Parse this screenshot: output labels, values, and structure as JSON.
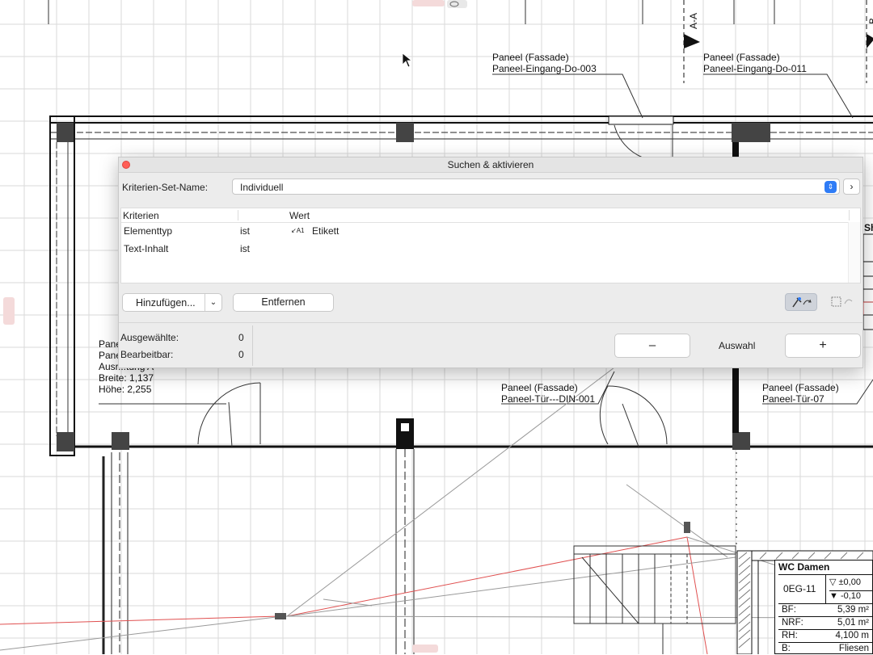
{
  "dialog": {
    "title": "Suchen & aktivieren",
    "set_label": "Kriterien-Set-Name:",
    "set_value": "Individuell",
    "more_glyph": "›",
    "table": {
      "headers": [
        "Kriterien",
        "Wert"
      ],
      "rows": [
        {
          "criterion": "Elementtyp",
          "operator": "ist",
          "value_icon": "label-tool-icon",
          "value_icon_text": "A1",
          "value": "Etikett"
        },
        {
          "criterion": "Text-Inhalt",
          "operator": "ist",
          "value": ""
        }
      ]
    },
    "add_button": "Hinzufügen...",
    "remove_button": "Entfernen",
    "selected_label": "Ausgewählte:",
    "selected_count": "0",
    "editable_label": "Bearbeitbar:",
    "editable_count": "0",
    "selection_label": "Auswahl",
    "minus_button": "–",
    "plus_button": "+",
    "icons": [
      "close-icon",
      "stepper-icon",
      "chevron-right-icon",
      "chevron-down-icon",
      "eyedropper-icon",
      "marquee-icon"
    ]
  },
  "plan": {
    "section_marker_a": "A-A",
    "section_marker_b": "B",
    "labels": [
      {
        "line1": "Paneel (Fassade)",
        "line2": "Paneel-Eingang-Do-003"
      },
      {
        "line1": "Paneel (Fassade)",
        "line2": "Paneel-Eingang-Do-011"
      },
      {
        "line1": "Paneel (Fassade)",
        "line2": "Paneel-Tür---DIN-001"
      },
      {
        "line1": "Paneel (Fassade)",
        "line2": "Paneel-Tür-07"
      }
    ],
    "left_label": {
      "l1": "Pane",
      "l2": "Pane",
      "l3": "Ausr...tung A",
      "l4": "Breite: 1,137",
      "l5": "Höhe: 2,255"
    },
    "right_edge_label": "Sh",
    "room": {
      "name": "WC Damen",
      "id": "0EG-11",
      "level_top": "▽ ±0,00",
      "level_bottom": "▼ -0,10",
      "rows": [
        {
          "k": "BF:",
          "v": "5,39 m²"
        },
        {
          "k": "NRF:",
          "v": "5,01 m²"
        },
        {
          "k": "RH:",
          "v": "4,100 m"
        },
        {
          "k": "B:",
          "v": "Fliesen"
        }
      ]
    },
    "colors": {
      "accent": "#2f7cf6",
      "close": "#ff5f57",
      "red_line": "#e05050",
      "grid": "#d8d8d8"
    }
  }
}
